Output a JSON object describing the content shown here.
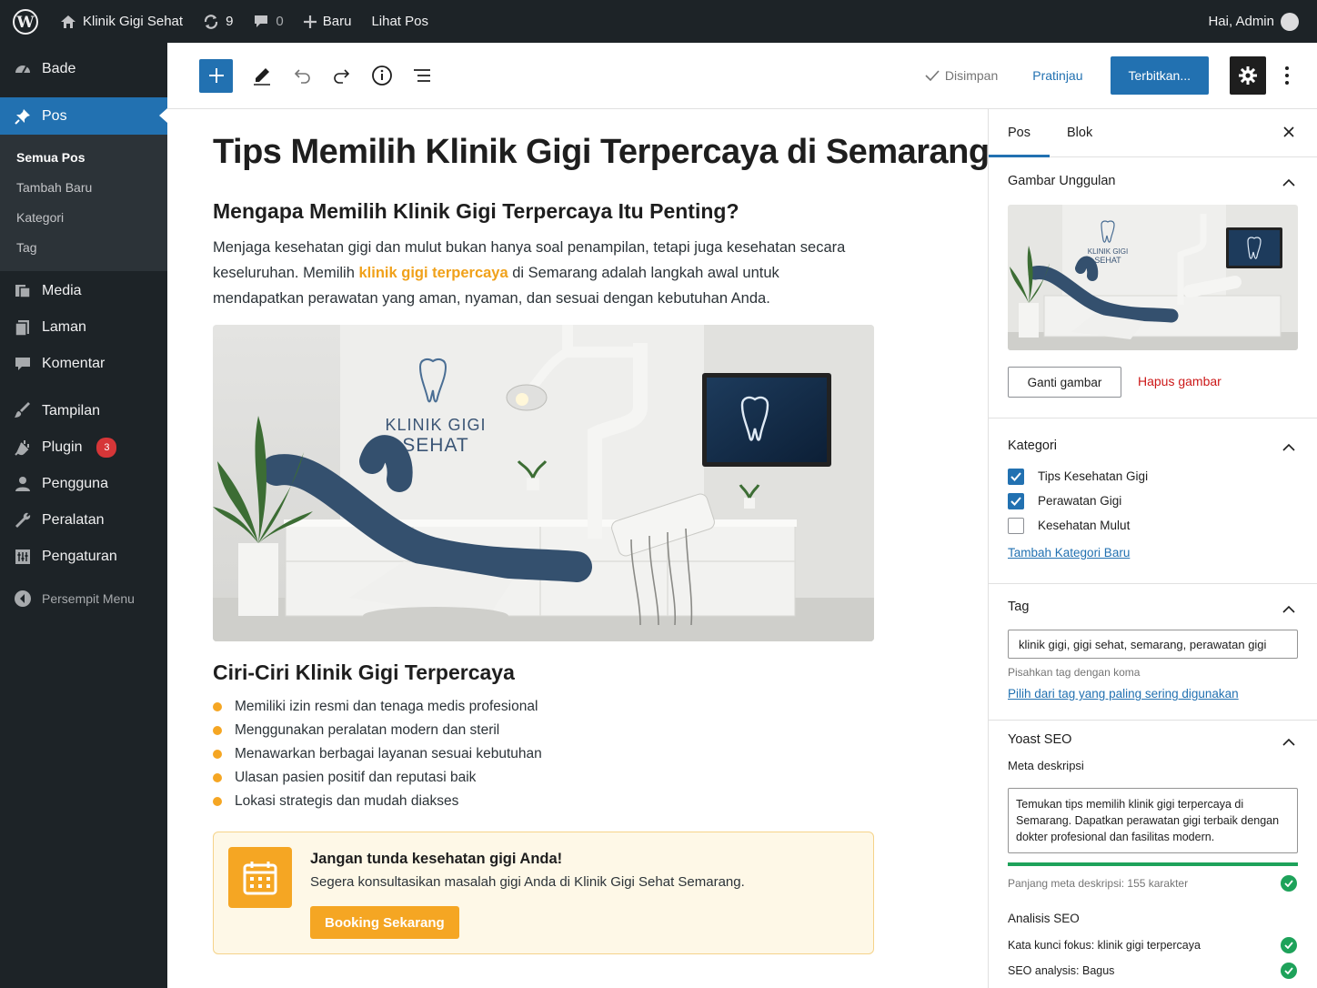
{
  "adminbar": {
    "site_name": "Klinik Gigi Sehat",
    "updates_count": "9",
    "comments_count": "0",
    "new_label": "Baru",
    "view_post_label": "Lihat Pos",
    "greeting": "Hai, Admin"
  },
  "sidebar": {
    "dashboard": "Bade",
    "posts": "Pos",
    "posts_sub": [
      "Semua Pos",
      "Tambah Baru",
      "Kategori",
      "Tag"
    ],
    "media": "Media",
    "pages": "Laman",
    "comments": "Komentar",
    "appearance": "Tampilan",
    "plugins": "Plugin",
    "plugins_badge": "3",
    "users": "Pengguna",
    "tools": "Peralatan",
    "settings": "Pengaturan",
    "collapse": "Persempit Menu"
  },
  "toolbar": {
    "saved_label": "Disimpan",
    "preview_label": "Pratinjau",
    "publish_label": "Terbitkan..."
  },
  "post": {
    "title": "Tips Memilih Klinik Gigi Terpercaya di Semarang",
    "heading1": "Mengapa Memilih Klinik Gigi Terpercaya Itu Penting?",
    "para_before": "Menjaga kesehatan gigi dan mulut bukan hanya soal penampilan, tetapi juga kesehatan secara keseluruhan. Memilih ",
    "para_link": "klinik gigi terpercaya",
    "para_after": " di Semarang adalah langkah awal untuk mendapatkan perawatan yang aman, nyaman, dan sesuai dengan kebutuhan Anda.",
    "image_sign_line1": "KLINIK GIGI",
    "image_sign_line2": "SEHAT",
    "heading2": "Ciri-Ciri Klinik Gigi Terpercaya",
    "bullets": [
      "Memiliki izin resmi dan tenaga medis profesional",
      "Menggunakan peralatan modern dan steril",
      "Menawarkan berbagai layanan sesuai kebutuhan",
      "Ulasan pasien positif dan reputasi baik",
      "Lokasi strategis dan mudah diakses"
    ],
    "cta_title": "Jangan tunda kesehatan gigi Anda!",
    "cta_text": "Segera konsultasikan masalah gigi Anda di Klinik Gigi Sehat Semarang.",
    "cta_button": "Booking Sekarang"
  },
  "settings": {
    "tab_post": "Pos",
    "tab_block": "Blok",
    "featured_title": "Gambar Unggulan",
    "replace_image": "Ganti gambar",
    "remove_image": "Hapus gambar",
    "categories_title": "Kategori",
    "categories": [
      {
        "label": "Tips Kesehatan Gigi",
        "checked": true
      },
      {
        "label": "Perawatan Gigi",
        "checked": true
      },
      {
        "label": "Kesehatan Mulut",
        "checked": false
      }
    ],
    "add_category": "Tambah Kategori Baru",
    "tags_title": "Tag",
    "tags_value": "klinik gigi, gigi sehat, semarang, perawatan gigi",
    "tags_help": "Pisahkan tag dengan koma",
    "tags_popular": "Pilih dari tag yang paling sering digunakan",
    "yoast_title": "Yoast SEO",
    "meta_label": "Meta deskripsi",
    "meta_value": "Temukan tips memilih klinik gigi terpercaya di Semarang. Dapatkan perawatan gigi terbaik dengan dokter profesional dan fasilitas modern.",
    "meta_length": "Panjang meta deskripsi: 155 karakter",
    "meta_progress": 1.0,
    "analysis_title": "Analisis SEO",
    "focus_keyword": "Kata kunci fokus: klinik gigi terpercaya",
    "seo_analysis": "SEO analysis: Bagus"
  },
  "colors": {
    "admin_dark": "#1d2327",
    "wp_blue": "#2271b1",
    "accent_orange": "#f5a623",
    "seo_green": "#1ea25a"
  }
}
